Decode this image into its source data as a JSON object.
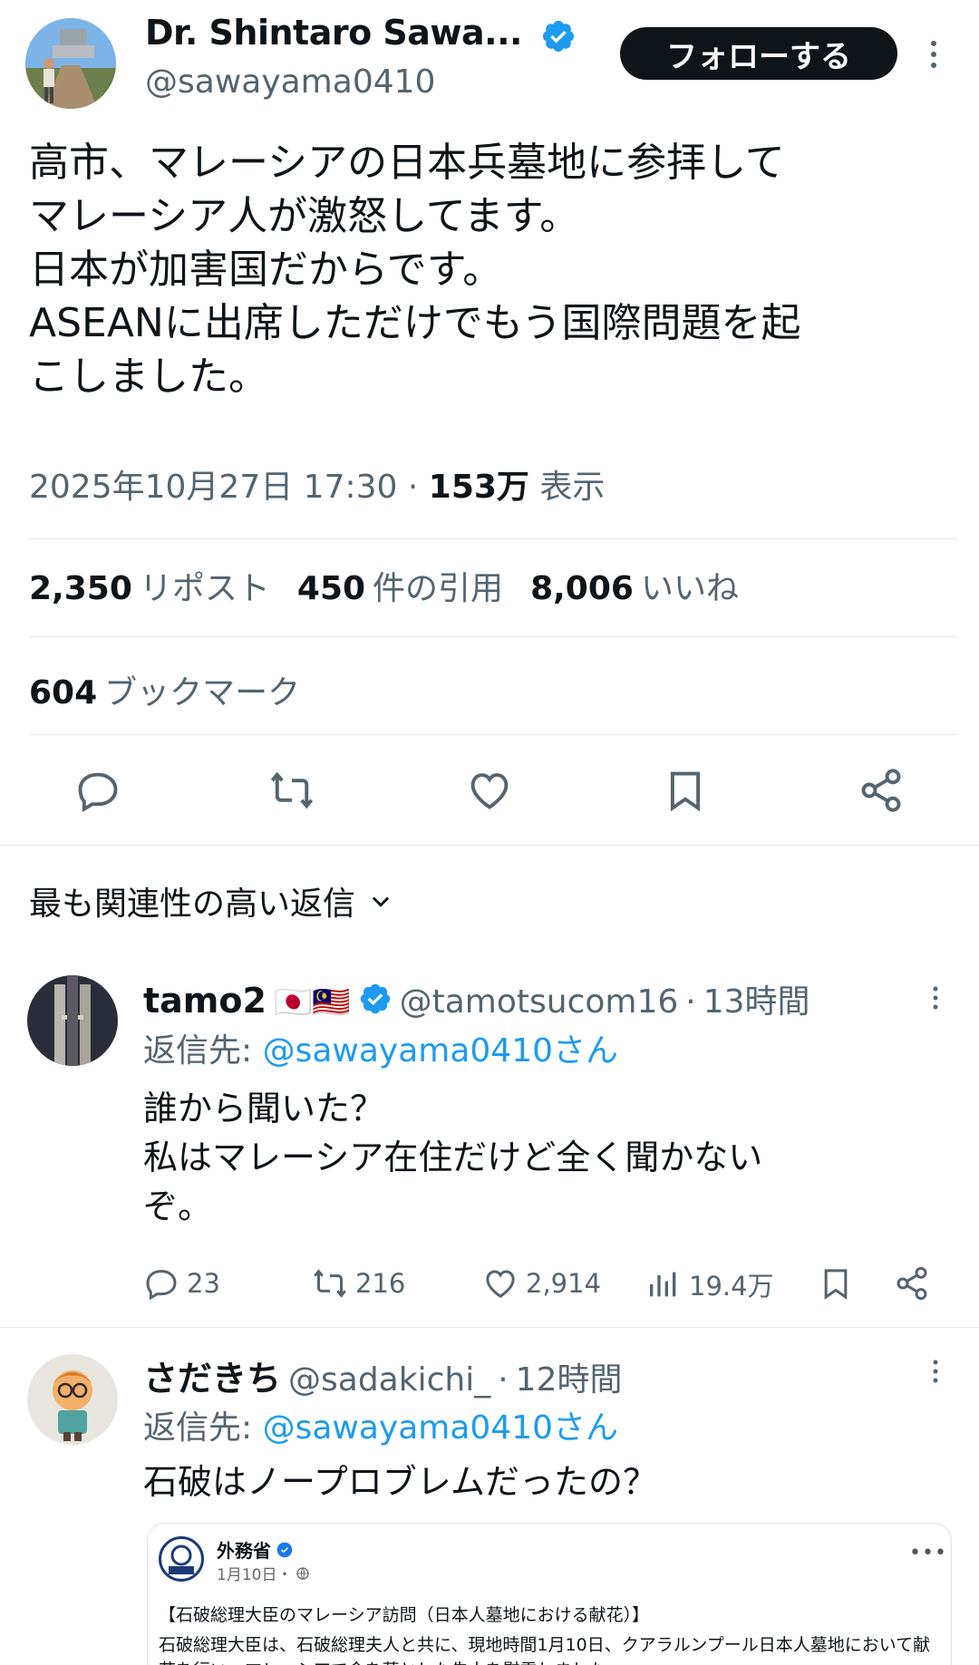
{
  "tweet": {
    "author_name": "Dr. Shintaro Sawa...",
    "author_handle": "@sawayama0410",
    "follow_label": "フォローする",
    "text": "高市、マレーシアの日本兵墓地に参拝して\nマレーシア人が激怒してます。\n日本が加害国だからです。\nASEANに出席しただけでもう国際問題を起\nこしました。",
    "date": "2025年10月27日 17:30",
    "views_count": "153万",
    "views_label": "表示",
    "reposts_count": "2,350",
    "reposts_label": "リポスト",
    "quotes_count": "450",
    "quotes_label": "件の引用",
    "likes_count": "8,006",
    "likes_label": "いいね",
    "bookmarks_count": "604",
    "bookmarks_label": "ブックマーク"
  },
  "replies_header": "最も関連性の高い返信",
  "replies": [
    {
      "name": "tamo2",
      "flags": "🇯🇵🇲🇾",
      "handle": "@tamotsucom16",
      "time": "13時間",
      "reply_to_prefix": "返信先: ",
      "reply_to": "@sawayama0410さん",
      "text": "誰から聞いた？\n私はマレーシア在住だけど全く聞かない\nぞ。",
      "comments": "23",
      "reposts": "216",
      "likes": "2,914",
      "views": "19.4万"
    },
    {
      "name": "さだきち",
      "handle": "@sadakichi_",
      "time": "12時間",
      "reply_to_prefix": "返信先: ",
      "reply_to": "@sawayama0410さん",
      "text": "石破はノープロブレムだったの？"
    }
  ],
  "embed": {
    "logo_text": "外務省",
    "name": "外務省",
    "date": "1月10日・",
    "title": "【石破総理大臣のマレーシア訪問（日本人墓地における献花）】",
    "body": "石破総理大臣は、石破総理夫人と共に、現地時間1月10日、クアラルンプール日本人墓地において献花を行い、マレーシアで命を落とした先人を慰霊しました。"
  },
  "colors": {
    "text": "#0f1419",
    "secondary": "#536471",
    "link": "#1d9bf0",
    "verified": "#1d9bf0"
  }
}
